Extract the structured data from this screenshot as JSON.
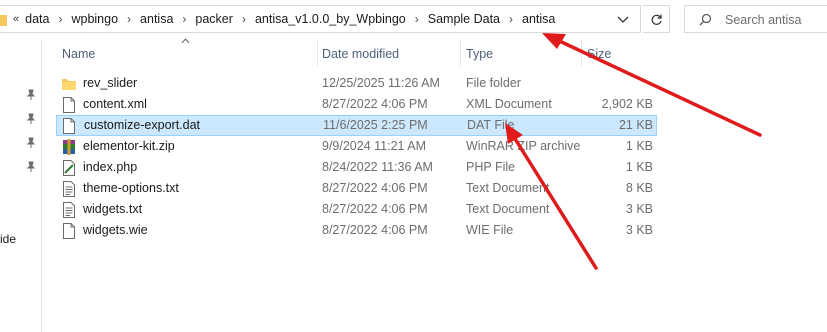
{
  "address_bar": {
    "overflow_label": "«",
    "breadcrumbs": [
      "data",
      "wpbingo",
      "antisa",
      "packer",
      "antisa_v1.0.0_by_Wpbingo",
      "Sample Data",
      "antisa"
    ]
  },
  "search": {
    "placeholder": "Search antisa"
  },
  "nav": {
    "partial_label": "ide"
  },
  "columns": {
    "name": "Name",
    "date": "Date modified",
    "type": "Type",
    "size": "Size"
  },
  "files": [
    {
      "name": "rev_slider",
      "date": "12/25/2025 11:26 AM",
      "type": "File folder",
      "size": "",
      "icon": "folder-icon"
    },
    {
      "name": "content.xml",
      "date": "8/27/2022 4:06 PM",
      "type": "XML Document",
      "size": "2,902 KB",
      "icon": "file-icon"
    },
    {
      "name": "customize-export.dat",
      "date": "11/6/2025 2:25 PM",
      "type": "DAT File",
      "size": "21 KB",
      "icon": "file-icon",
      "selected": true
    },
    {
      "name": "elementor-kit.zip",
      "date": "9/9/2024 11:21 AM",
      "type": "WinRAR ZIP archive",
      "size": "1 KB",
      "icon": "winrar-icon"
    },
    {
      "name": "index.php",
      "date": "8/24/2022 11:36 AM",
      "type": "PHP File",
      "size": "1 KB",
      "icon": "php-file-icon"
    },
    {
      "name": "theme-options.txt",
      "date": "8/27/2022 4:06 PM",
      "type": "Text Document",
      "size": "8 KB",
      "icon": "text-file-icon"
    },
    {
      "name": "widgets.txt",
      "date": "8/27/2022 4:06 PM",
      "type": "Text Document",
      "size": "3 KB",
      "icon": "text-file-icon"
    },
    {
      "name": "widgets.wie",
      "date": "8/27/2022 4:06 PM",
      "type": "WIE File",
      "size": "3 KB",
      "icon": "file-icon"
    }
  ],
  "colors": {
    "selection_bg": "#cce8ff",
    "selection_border": "#99d1ff",
    "annotation_arrow": "#e01b1b",
    "folder": "#f6c85f"
  }
}
